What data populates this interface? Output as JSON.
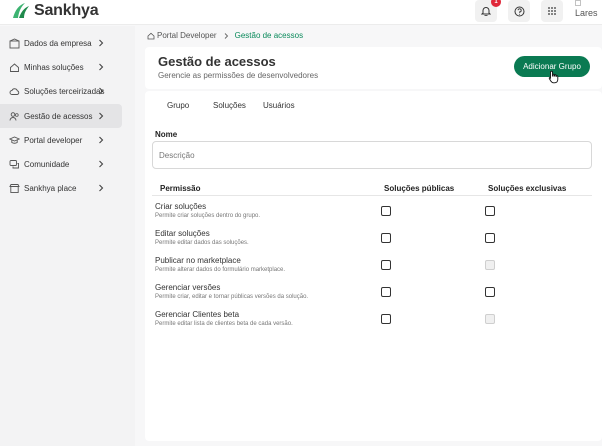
{
  "app": {
    "brand": "Sankhya",
    "brand_color": "#2f9e5f",
    "notification_count": "1",
    "avatar_alt": "Lares"
  },
  "sidebar": {
    "items": [
      {
        "label": "Dados da empresa",
        "icon": "building-icon"
      },
      {
        "label": "Minhas soluções",
        "icon": "home-icon"
      },
      {
        "label": "Soluções terceirizadas",
        "icon": "cloud-icon"
      },
      {
        "label": "Gestão de acessos",
        "icon": "users-icon"
      },
      {
        "label": "Portal developer",
        "icon": "graduation-cap-icon"
      },
      {
        "label": "Comunidade",
        "icon": "chat-icon"
      },
      {
        "label": "Sankhya place",
        "icon": "store-icon"
      }
    ]
  },
  "breadcrumb": {
    "root": "Portal Developer",
    "current": "Gestão de acessos"
  },
  "header": {
    "title": "Gestão de acessos",
    "subtitle": "Gerencie as permissões de desenvolvedores",
    "add_button": "Adicionar Grupo"
  },
  "tabs": [
    "Grupo",
    "Soluções",
    "Usuários"
  ],
  "form": {
    "name_label": "Nome",
    "description_placeholder": "Descrição"
  },
  "table": {
    "headers": [
      "Permissão",
      "Soluções públicas",
      "Soluções exclusivas"
    ],
    "rows": [
      {
        "title": "Criar soluções",
        "desc": "Permite criar soluções dentro do grupo.",
        "public_enabled": true,
        "exclusive_enabled": true
      },
      {
        "title": "Editar soluções",
        "desc": "Permite editar dados das soluções.",
        "public_enabled": true,
        "exclusive_enabled": true
      },
      {
        "title": "Publicar no marketplace",
        "desc": "Permite alterar dados do formulário marketplace.",
        "public_enabled": true,
        "exclusive_enabled": false
      },
      {
        "title": "Gerenciar versões",
        "desc": "Permite criar, editar e tornar públicas versões da solução.",
        "public_enabled": true,
        "exclusive_enabled": true
      },
      {
        "title": "Gerenciar Clientes beta",
        "desc": "Permite editar lista de clientes beta de cada versão.",
        "public_enabled": true,
        "exclusive_enabled": false
      }
    ]
  }
}
